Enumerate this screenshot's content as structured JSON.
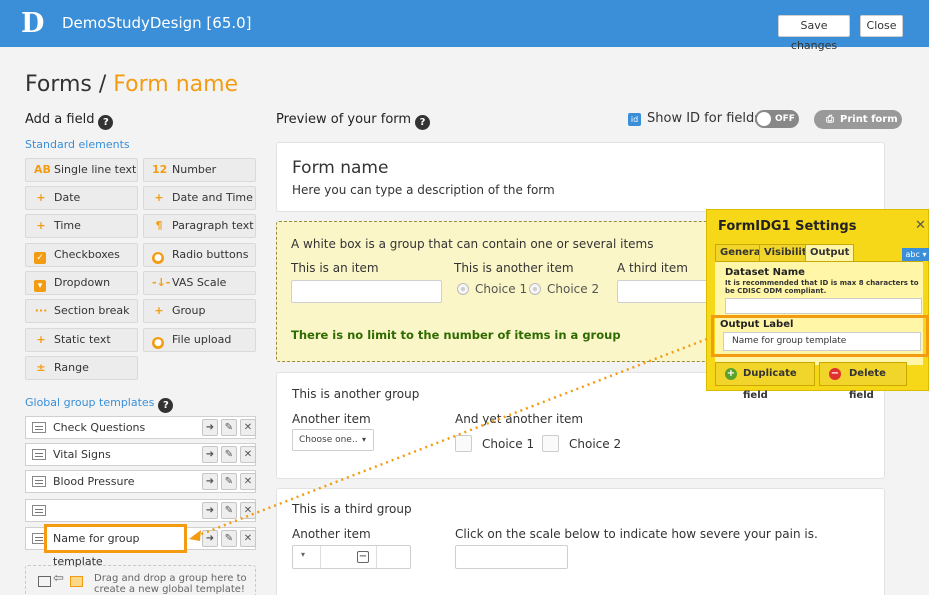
{
  "header": {
    "logo": "D",
    "title": "DemoStudyDesign [65.0]",
    "save_label": "Save changes",
    "close_label": "Close"
  },
  "page": {
    "title": "Forms / ",
    "title_accent": "Form name"
  },
  "left": {
    "add_field": "Add a field",
    "help": "?",
    "standard": "Standard elements",
    "fields": [
      {
        "icon": "AB",
        "label": "Single line text"
      },
      {
        "icon": "12",
        "label": "Number"
      },
      {
        "icon": "+",
        "label": "Date"
      },
      {
        "icon": "+",
        "label": "Date and Time"
      },
      {
        "icon": "+",
        "label": "Time"
      },
      {
        "icon": "¶",
        "label": "Paragraph text"
      },
      {
        "icon": "✓",
        "label": "Checkboxes"
      },
      {
        "icon": "●",
        "label": "Radio buttons"
      },
      {
        "icon": "▾",
        "label": "Dropdown"
      },
      {
        "icon": "-↓-",
        "label": "VAS Scale"
      },
      {
        "icon": "···",
        "label": "Section break"
      },
      {
        "icon": "+",
        "label": "Group"
      },
      {
        "icon": "+",
        "label": "Static text"
      },
      {
        "icon": "●",
        "label": "File upload"
      },
      {
        "icon": "±",
        "label": "Range"
      }
    ],
    "global_title": "Global group templates",
    "templates": [
      "Check Questions",
      "Vital Signs",
      "Blood Pressure",
      "",
      "Name for group template"
    ],
    "drop_text": "Drag and drop a group here to create a new global template!"
  },
  "preview": {
    "title": "Preview of your form",
    "help": "?",
    "show_id": "Show ID for fields",
    "toggle": "OFF",
    "print": "Print form",
    "form_name": "Form name",
    "form_desc": "Here you can type a description of the form",
    "group1": {
      "title": "A white box is a group that can contain one or several items",
      "item1": "This is an item",
      "item2": "This is another item",
      "item3": "A third item",
      "choice1": "Choice 1",
      "choice2": "Choice 2",
      "note": "There is no limit to the number of items in a group"
    },
    "group2": {
      "title": "This is another group",
      "item1": "Another item",
      "item2": "And yet another item",
      "select": "Choose one..",
      "choice1": "Choice 1",
      "choice2": "Choice 2"
    },
    "group3": {
      "title": "This is a third group",
      "item1": "Another item",
      "item2": "Click on the scale below to indicate how severe your pain is."
    }
  },
  "settings": {
    "title": "FormIDG1 Settings",
    "close": "✕",
    "tabs": [
      "General",
      "Visibility",
      "Output"
    ],
    "abc": "abc ▾",
    "dataset_label": "Dataset Name",
    "dataset_hint": "It is recommended that ID is max 8 characters to be CDISC ODM compliant.",
    "output_label": "Output Label",
    "output_value": "Name for group template",
    "duplicate": "Duplicate field",
    "delete": "Delete field"
  },
  "colors": {
    "header": "#3a8fd8",
    "accent": "#f39c12",
    "panel": "#f6d819",
    "group_bg": "#fbf6c8",
    "green_note": "#2e6b00"
  }
}
